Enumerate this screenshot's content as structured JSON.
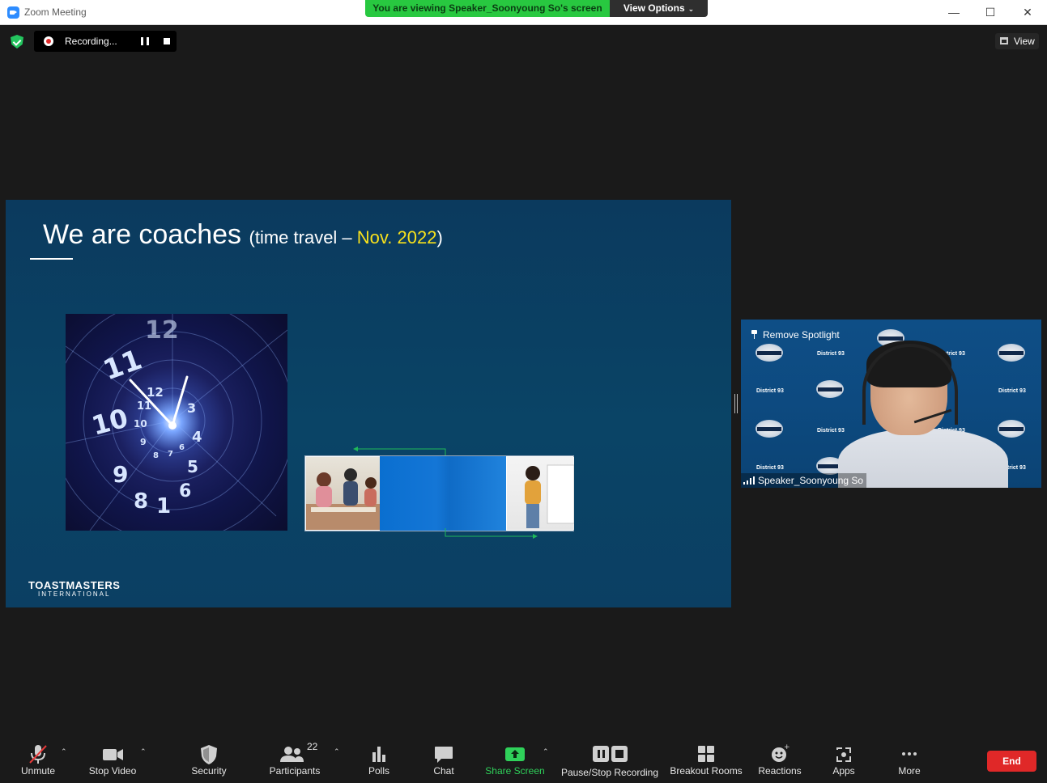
{
  "window": {
    "title": "Zoom Meeting",
    "viewing_banner": "You are viewing Speaker_Soonyoung So's screen",
    "view_options_label": "View Options"
  },
  "meeting_bar": {
    "recording_label": "Recording...",
    "view_label": "View"
  },
  "slide": {
    "title_main": "We are coaches",
    "title_sub_prefix": "(time travel – ",
    "title_highlight": "Nov. 2022",
    "title_sub_suffix": ")",
    "footer_logo": "TOASTMASTERS",
    "footer_logo_sub": "INTERNATIONAL"
  },
  "speaker": {
    "spotlight_label": "Remove Spotlight",
    "name": "Speaker_Soonyoung So",
    "background_labels": [
      "District 93",
      "District 93",
      "District 93",
      "District 93",
      "District 93",
      "District 93",
      "District 93",
      "District 93",
      "District 93"
    ]
  },
  "toolbar": {
    "unmute": "Unmute",
    "stop_video": "Stop Video",
    "security": "Security",
    "participants": "Participants",
    "participant_count": "22",
    "polls": "Polls",
    "chat": "Chat",
    "share_screen": "Share Screen",
    "pause_stop_recording": "Pause/Stop Recording",
    "breakout_rooms": "Breakout Rooms",
    "reactions": "Reactions",
    "apps": "Apps",
    "more": "More",
    "end": "End"
  },
  "colors": {
    "accent_green": "#28c840",
    "end_red": "#e02828",
    "slide_highlight": "#f8e11c"
  }
}
